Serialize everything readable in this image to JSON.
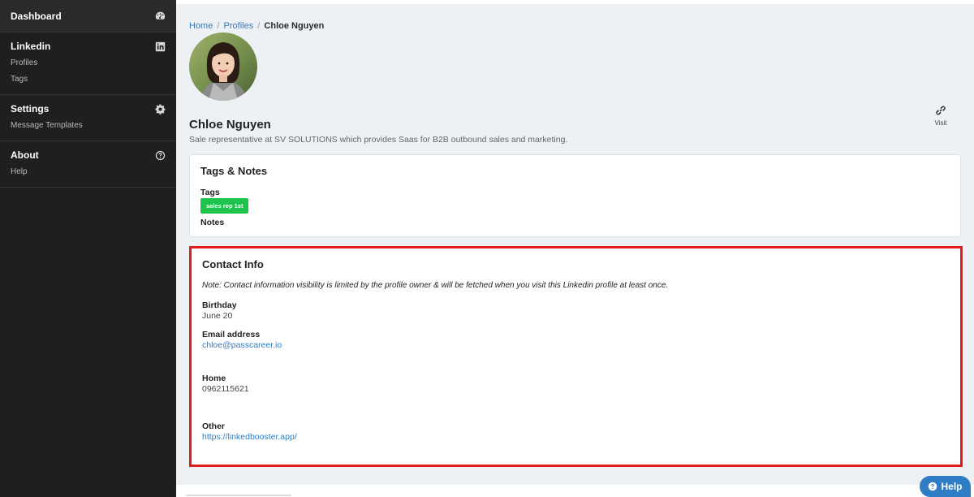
{
  "sidebar": {
    "dashboard": {
      "label": "Dashboard",
      "icon": "speedometer-icon"
    },
    "linkedin": {
      "label": "Linkedin",
      "icon": "linkedin-icon",
      "items": [
        "Profiles",
        "Tags"
      ]
    },
    "settings": {
      "label": "Settings",
      "icon": "gear-icon",
      "items": [
        "Message Templates"
      ]
    },
    "about": {
      "label": "About",
      "icon": "question-circle-icon",
      "items": [
        "Help"
      ]
    }
  },
  "breadcrumb": {
    "home": "Home",
    "profiles": "Profiles",
    "separator": "/",
    "current": "Chloe Nguyen"
  },
  "profile": {
    "name": "Chloe Nguyen",
    "headline": "Sale representative at SV SOLUTIONS which provides Saas for B2B outbound sales and marketing.",
    "visit_label": "Visit"
  },
  "tags_notes": {
    "title": "Tags & Notes",
    "tags_label": "Tags",
    "tags": [
      "sales rep 1st"
    ],
    "notes_label": "Notes"
  },
  "contact": {
    "title": "Contact Info",
    "note": "Note: Contact information visibility is limited by the profile owner & will be fetched when you visit this Linkedin profile at least once.",
    "birthday_label": "Birthday",
    "birthday_value": "June 20",
    "email_label": "Email address",
    "email_value": "chloe@passcareer.io",
    "home_label": "Home",
    "home_value": "0962115621",
    "other_label": "Other",
    "other_value": "https://linkedbooster.app/"
  },
  "help_button": {
    "label": "Help"
  },
  "colors": {
    "accent": "#2f7dc4",
    "tag": "#1ec34c",
    "highlight": "#e11c1c",
    "sidebar": "#1f1f1f"
  }
}
